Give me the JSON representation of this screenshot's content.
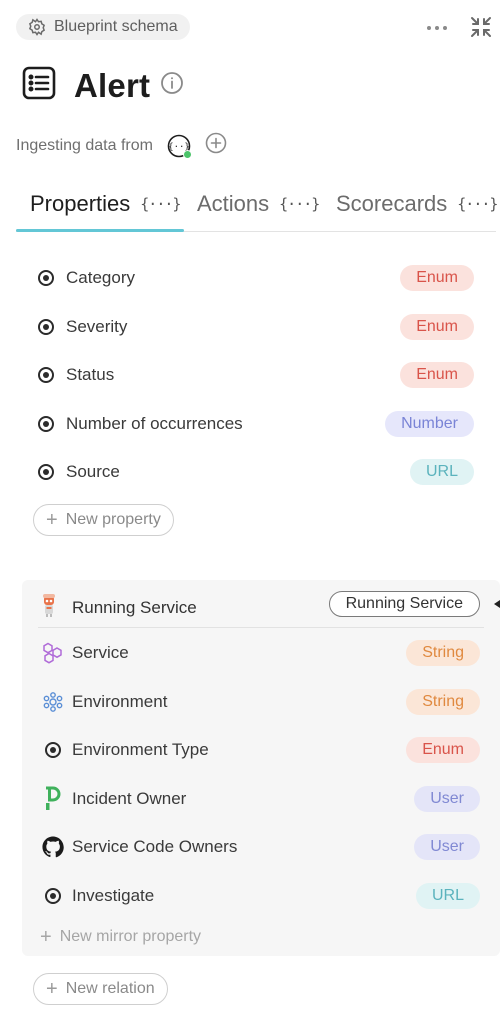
{
  "header": {
    "schema_label": "Blueprint schema",
    "title": "Alert",
    "ingest_label": "Ingesting data from"
  },
  "tabs": [
    {
      "label": "Properties",
      "brace": "{···}",
      "active": true
    },
    {
      "label": "Actions",
      "brace": "{···}",
      "active": false
    },
    {
      "label": "Scorecards",
      "brace": "{···}",
      "active": false
    }
  ],
  "properties": [
    {
      "label": "Category",
      "type": "Enum",
      "type_style": "enum"
    },
    {
      "label": "Severity",
      "type": "Enum",
      "type_style": "enum"
    },
    {
      "label": "Status",
      "type": "Enum",
      "type_style": "enum"
    },
    {
      "label": "Number of occurrences",
      "type": "Number",
      "type_style": "number"
    },
    {
      "label": "Source",
      "type": "URL",
      "type_style": "url"
    }
  ],
  "new_property_label": "New property",
  "relation": {
    "label": "Running Service",
    "target": "Running Service",
    "icon": "robot-icon",
    "mirrors": [
      {
        "label": "Service",
        "type": "String",
        "icon": "service-icon"
      },
      {
        "label": "Environment",
        "type": "String",
        "icon": "environment-icon"
      },
      {
        "label": "Environment Type",
        "type": "Enum",
        "icon": "enum-icon"
      },
      {
        "label": "Incident Owner",
        "type": "User",
        "icon": "pagerduty-icon"
      },
      {
        "label": "Service Code Owners",
        "type": "User",
        "icon": "github-icon"
      },
      {
        "label": "Investigate",
        "type": "URL",
        "icon": "url-icon"
      }
    ],
    "new_mirror_label": "New mirror property"
  },
  "new_relation_label": "New relation",
  "colors": {
    "accent": "#63c7d6",
    "enum": "#d9544a",
    "string": "#e0893f",
    "user": "#8089d3",
    "url": "#5bb3bd",
    "status_online": "#4cc46a"
  }
}
